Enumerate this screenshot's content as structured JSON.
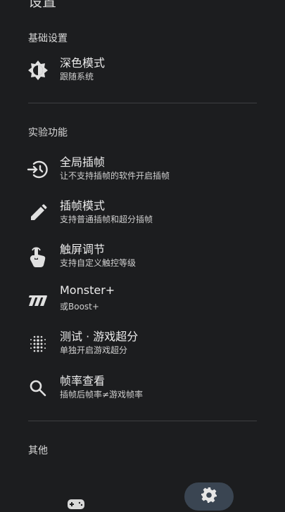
{
  "page": {
    "title": "设置"
  },
  "sections": {
    "basic": "基础设置",
    "experimental": "实验功能",
    "other": "其他"
  },
  "items": [
    {
      "id": "dark-mode",
      "title": "深色模式",
      "subtitle": "跟随系统",
      "icon": "brightness-auto-icon"
    },
    {
      "id": "global-frame-interpolation",
      "title": "全局插帧",
      "subtitle": "让不支持插帧的软件开启插帧",
      "icon": "frame-interpolation-icon"
    },
    {
      "id": "frame-interpolation-mode",
      "title": "插帧模式",
      "subtitle": "支持普通插帧和超分插帧",
      "icon": "pencil-icon"
    },
    {
      "id": "touch-adjust",
      "title": "触屏调节",
      "subtitle": "支持自定义触控等级",
      "icon": "touch-hand-icon"
    },
    {
      "id": "monster-plus",
      "title": "Monster+",
      "subtitle": "或Boost+",
      "icon": "monster-logo-icon"
    },
    {
      "id": "test-game-super-resolution",
      "title": "测试 · 游戏超分",
      "subtitle": "单独开启游戏超分",
      "icon": "dot-grid-icon"
    },
    {
      "id": "frame-rate-view",
      "title": "帧率查看",
      "subtitle": "插帧后帧率≠游戏帧率",
      "icon": "search-icon"
    }
  ],
  "bottom_nav": {
    "items": [
      {
        "icon": "gamepad-icon",
        "selected": false
      },
      {
        "icon": "gear-icon",
        "selected": true
      }
    ],
    "selected_color": "#3a4552"
  }
}
